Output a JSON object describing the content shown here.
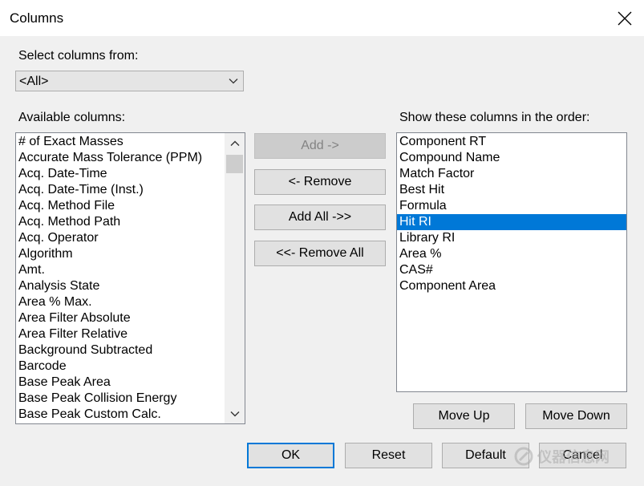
{
  "window": {
    "title": "Columns"
  },
  "select_from": {
    "label": "Select columns from:",
    "value": "<All>"
  },
  "available": {
    "label": "Available columns:",
    "items": [
      "# of Exact Masses",
      "Accurate Mass Tolerance (PPM)",
      "Acq. Date-Time",
      "Acq. Date-Time (Inst.)",
      "Acq. Method File",
      "Acq. Method Path",
      "Acq. Operator",
      "Algorithm",
      "Amt.",
      "Analysis State",
      "Area % Max.",
      "Area Filter Absolute",
      "Area Filter Relative",
      "Background Subtracted",
      "Barcode",
      "Base Peak Area",
      "Base Peak Collision Energy",
      "Base Peak Custom Calc."
    ]
  },
  "shown": {
    "label": "Show these columns in the order:",
    "items": [
      "Component RT",
      "Compound Name",
      "Match Factor",
      "Best Hit",
      "Formula",
      "Hit RI",
      "Library RI",
      "Area %",
      "CAS#",
      "Component Area"
    ],
    "selected_index": 5
  },
  "buttons": {
    "add": "Add ->",
    "remove": "<- Remove",
    "add_all": "Add All ->>",
    "remove_all": "<<- Remove All",
    "move_up": "Move Up",
    "move_down": "Move Down",
    "ok": "OK",
    "reset": "Reset",
    "default": "Default",
    "cancel": "Cancel"
  },
  "watermark": {
    "text": "仪器信息网"
  },
  "colors": {
    "selection": "#0078d7",
    "focus_border": "#0078d7"
  }
}
